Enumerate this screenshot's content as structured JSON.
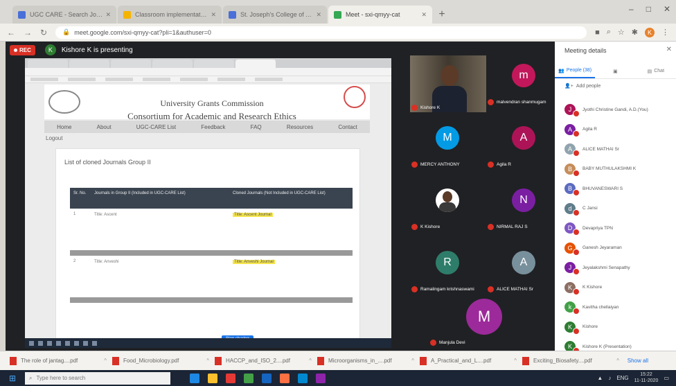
{
  "browser": {
    "tabs": [
      {
        "label": "UGC CARE - Search Journal",
        "active": false,
        "color": "#4a6fd8"
      },
      {
        "label": "Classroom implementation of...",
        "active": false,
        "color": "#f4b400"
      },
      {
        "label": "St. Joseph's College of Arts & Sc...",
        "active": false,
        "color": "#4a6fd8"
      },
      {
        "label": "Meet - sxi-qmyy-cat",
        "active": true,
        "color": "#34a853"
      }
    ],
    "url": "meet.google.com/sxi-qmyy-cat?pli=1&authuser=0"
  },
  "meet": {
    "rec_label": "REC",
    "presenter_initial": "K",
    "presenter_text": "Kishore K is presenting",
    "shared_screen": {
      "title_line1": "University Grants Commission",
      "title_line2": "Consortium for Academic and Research Ethics (UGC-CARE)",
      "menu": [
        "Home",
        "About",
        "UGC-CARE List",
        "Feedback",
        "FAQ",
        "Resources",
        "Contact"
      ],
      "login": "Logout",
      "card_heading": "List of cloned Journals Group II",
      "table_head": {
        "no": "Sr. No.",
        "left": "Journals in Group II (Included in UGC-CARE List)",
        "right": "Cloned Journals (Not Included in UGC-CARE List)"
      },
      "rows": [
        {
          "no": "1",
          "left": "Title: Ascent",
          "right": "Title: Ascent Journal"
        },
        {
          "no": "2",
          "left": "Title: Anveshi",
          "right": "Title: Anveshi Journal"
        }
      ],
      "bottom_button": "Stop sharing"
    },
    "tiles": [
      {
        "name": "Kishore K",
        "type": "camera"
      },
      {
        "name": "malvendran shanmugam",
        "initial": "m",
        "color": "#c2185b"
      },
      {
        "name": "MERCY ANTHONY",
        "initial": "M",
        "color": "#039be5"
      },
      {
        "name": "Agila R",
        "initial": "A",
        "color": "#ad1457"
      },
      {
        "name": "K Kishore",
        "type": "photo"
      },
      {
        "name": "NIRMAL RAJ S",
        "initial": "N",
        "color": "#7b1fa2"
      },
      {
        "name": "Ramalingam krishnaswami",
        "initial": "R",
        "color": "#2e7d6a"
      },
      {
        "name": "ALICE MATHAI Sr",
        "initial": "A",
        "color": "#78909c"
      }
    ],
    "large_tile": {
      "name": "Manjula Devi",
      "initial": "M"
    }
  },
  "panel": {
    "title": "Meeting details",
    "tabs": {
      "people": "People (38)",
      "info": "",
      "chat": "Chat"
    },
    "add_people": "Add people",
    "participants": [
      {
        "initial": "J",
        "name": "Jyothi Christine Gandi, A.D.(You)",
        "color": "#ad1457"
      },
      {
        "initial": "A",
        "name": "Agila R",
        "color": "#7b1fa2"
      },
      {
        "initial": "A",
        "name": "ALICE MATHAI Sr",
        "color": "#90a4ae"
      },
      {
        "initial": "B",
        "name": "BABY MUTHULAKSHMI K",
        "color": "#c68d5a"
      },
      {
        "initial": "B",
        "name": "BHUVANESWARI S",
        "color": "#5c6bc0"
      },
      {
        "initial": "d",
        "name": "C Jansi",
        "color": "#607d8b"
      },
      {
        "initial": "D",
        "name": "Devapriya TPN",
        "color": "#7e57c2"
      },
      {
        "initial": "G",
        "name": "Ganesh Jeyaraman",
        "color": "#e65100"
      },
      {
        "initial": "J",
        "name": "Jeyalakshmi Senapathy",
        "color": "#7b1fa2"
      },
      {
        "initial": "K",
        "name": "K Kishore",
        "color": "#8d6e63"
      },
      {
        "initial": "k",
        "name": "Kavitha chellaiyan",
        "color": "#43a047"
      },
      {
        "initial": "K",
        "name": "Kishore",
        "color": "#2e7d32"
      },
      {
        "initial": "K",
        "name": "Kishore K (Presentation)",
        "color": "#2e7d32"
      }
    ]
  },
  "downloads": {
    "items": [
      "The role of jantag....pdf",
      "Food_Microbiology.pdf",
      "HACCP_and_ISO_2....pdf",
      "Microorganisms_in_....pdf",
      "A_Practical_and_L....pdf",
      "Exciting_Biosafety....pdf"
    ],
    "show_all": "Show all"
  },
  "taskbar": {
    "search_placeholder": "Type here to search",
    "lang": "ENG",
    "time": "15:22",
    "date": "11-11-2020",
    "icon_colors": [
      "#1e88e5",
      "#fbc02d",
      "#e53935",
      "#43a047",
      "#1565c0",
      "#ff7043",
      "#0288d1",
      "#8e24aa"
    ]
  }
}
